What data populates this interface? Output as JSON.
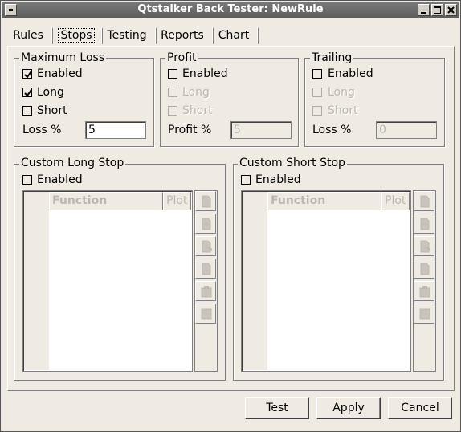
{
  "window": {
    "title": "Qtstalker Back Tester: NewRule"
  },
  "tabs": [
    {
      "label": "Rules"
    },
    {
      "label": "Stops",
      "active": true
    },
    {
      "label": "Testing"
    },
    {
      "label": "Reports"
    },
    {
      "label": "Chart"
    }
  ],
  "max_loss": {
    "title": "Maximum Loss",
    "enabled_label": "Enabled",
    "enabled_checked": true,
    "long_label": "Long",
    "long_checked": true,
    "short_label": "Short",
    "short_checked": false,
    "value_label": "Loss %",
    "value": "5"
  },
  "profit": {
    "title": "Profit",
    "enabled_label": "Enabled",
    "enabled_checked": false,
    "long_label": "Long",
    "short_label": "Short",
    "value_label": "Profit %",
    "value": "5"
  },
  "trailing": {
    "title": "Trailing",
    "enabled_label": "Enabled",
    "enabled_checked": false,
    "long_label": "Long",
    "short_label": "Short",
    "value_label": "Loss %",
    "value": "0"
  },
  "custom_long": {
    "title": "Custom Long Stop",
    "enabled_label": "Enabled",
    "col_function": "Function",
    "col_plot": "Plot"
  },
  "custom_short": {
    "title": "Custom Short Stop",
    "enabled_label": "Enabled",
    "col_function": "Function",
    "col_plot": "Plot"
  },
  "buttons": {
    "test": "Test",
    "apply": "Apply",
    "cancel": "Cancel"
  },
  "colors": {
    "background": "#efebe2",
    "titlebar": "#6b6b6b",
    "disabled_text": "#bcb8b0"
  },
  "icons": [
    "window-menu-icon",
    "minimize-icon",
    "maximize-icon",
    "close-icon",
    "new-icon",
    "edit-icon",
    "delete-icon",
    "copy-icon",
    "paste-icon",
    "stop-icon"
  ]
}
